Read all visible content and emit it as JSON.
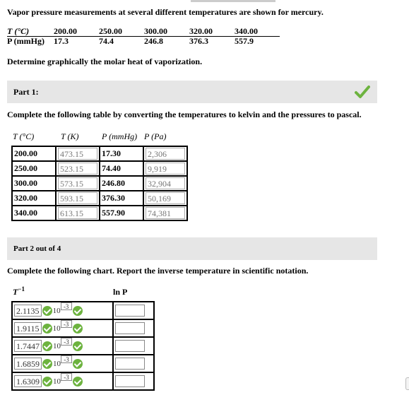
{
  "problem": {
    "intro": "Vapor pressure measurements at several different temperatures are shown for mercury.",
    "table": {
      "t_label": "T (°C)",
      "p_label": "P (mmHg)",
      "temps": [
        "200.00",
        "250.00",
        "300.00",
        "320.00",
        "340.00"
      ],
      "pressures": [
        "17.3",
        "74.4",
        "246.8",
        "376.3",
        "557.9"
      ]
    },
    "question": "Determine graphically the molar heat of vaporization."
  },
  "part1": {
    "label": "Part 1:",
    "instruction": "Complete the following table by converting the temperatures to kelvin and the pressures to pascal.",
    "headers": [
      "T (°C)",
      "T (K)",
      "P (mmHg)",
      "P (Pa)"
    ],
    "rows": [
      {
        "tc": "200.00",
        "tk": "473.15",
        "pmm": "17.30",
        "ppa": "2,306"
      },
      {
        "tc": "250.00",
        "tk": "523.15",
        "pmm": "74.40",
        "ppa": "9,919"
      },
      {
        "tc": "300.00",
        "tk": "573.15",
        "pmm": "246.80",
        "ppa": "32,904"
      },
      {
        "tc": "320.00",
        "tk": "593.15",
        "pmm": "376.30",
        "ppa": "50,169"
      },
      {
        "tc": "340.00",
        "tk": "613.15",
        "pmm": "557.90",
        "ppa": "74,381"
      }
    ]
  },
  "part2": {
    "label": "Part 2 out of 4",
    "instruction": "Complete the following chart. Report the inverse temperature in scientific notation.",
    "col1_header": "T",
    "col1_sup": "−1",
    "col2_header": "ln P",
    "ten": "10",
    "rows": [
      {
        "mantissa": "2.1135",
        "exponent": "-3",
        "lnp": ""
      },
      {
        "mantissa": "1.9115",
        "exponent": "-3",
        "lnp": ""
      },
      {
        "mantissa": "1.7447",
        "exponent": "-3",
        "lnp": ""
      },
      {
        "mantissa": "1.6859",
        "exponent": "-3",
        "lnp": ""
      },
      {
        "mantissa": "1.6309",
        "exponent": "-3",
        "lnp": ""
      }
    ]
  },
  "colors": {
    "part_bar": "#e6e6e6",
    "check_green": "#6db33f"
  },
  "icons": {
    "part1_status": "checkmark-icon",
    "cell_status": "check-circle-icon"
  }
}
